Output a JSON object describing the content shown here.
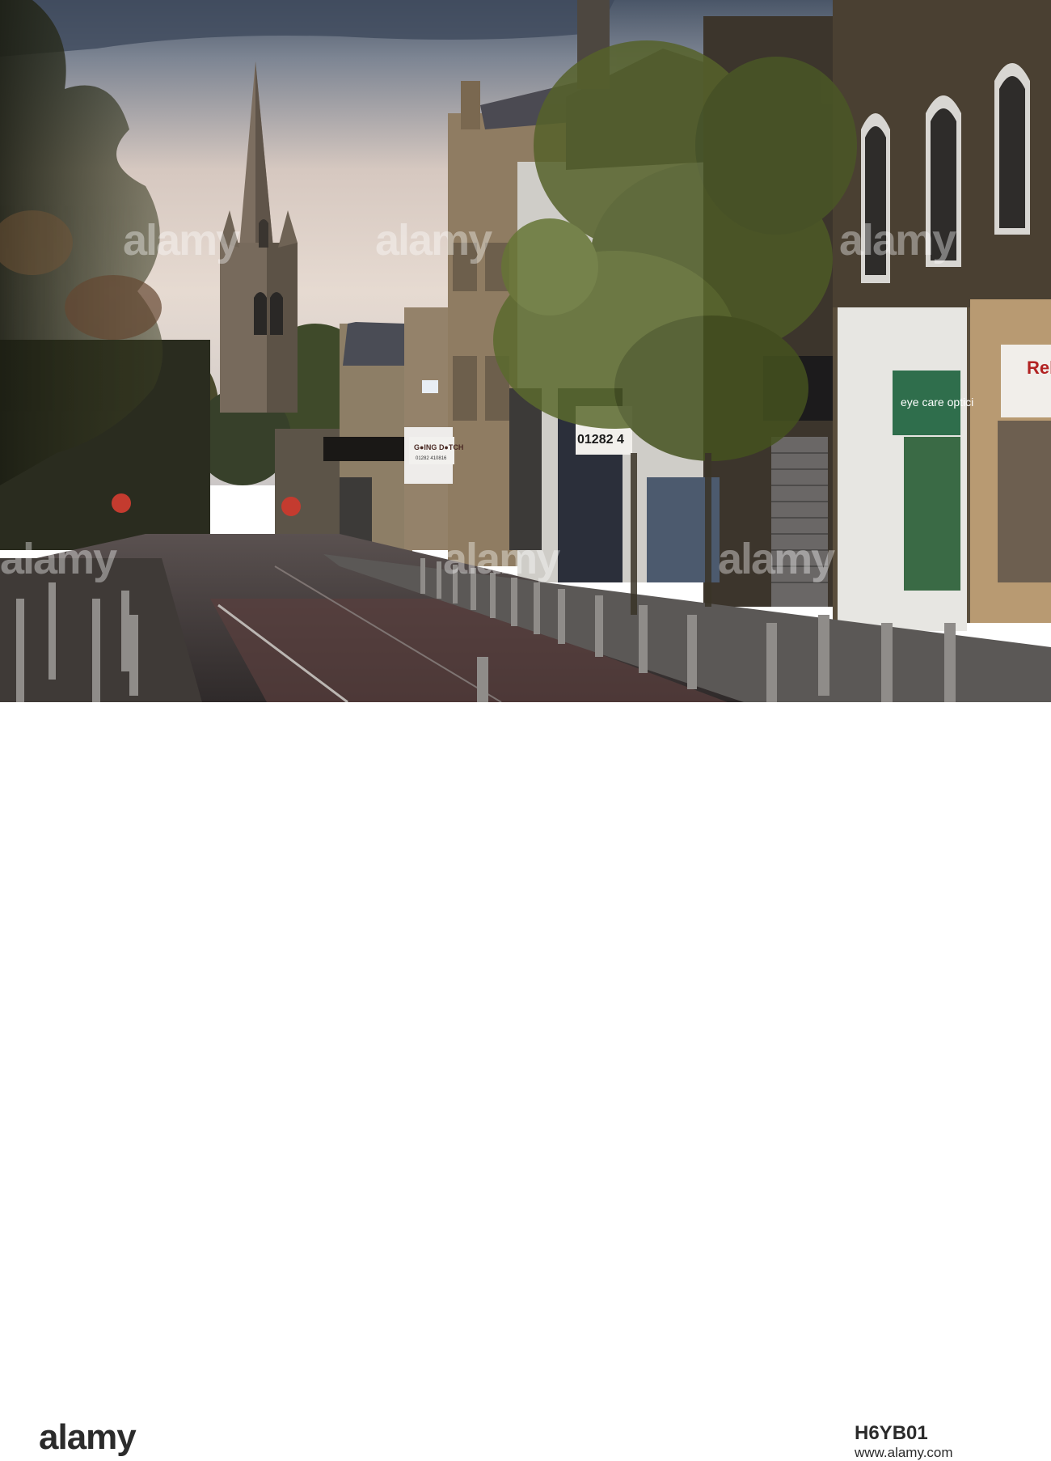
{
  "watermark": {
    "text": "alamy"
  },
  "footer": {
    "logo": "alamy",
    "image_id": "H6YB01",
    "url": "www.alamy.com"
  },
  "signs": {
    "going_dutch": "G●ING D●TCH",
    "going_dutch_phone": "01282 410816",
    "eye_care": "eye care optici",
    "phone_number": "01282 4",
    "reb": "Reb"
  },
  "colors": {
    "sky_top": "#4a5668",
    "sky_bottom": "#e8dcd2",
    "stone": "#8a7a62",
    "foliage": "#4e5a24",
    "road": "#4a3f3e"
  }
}
